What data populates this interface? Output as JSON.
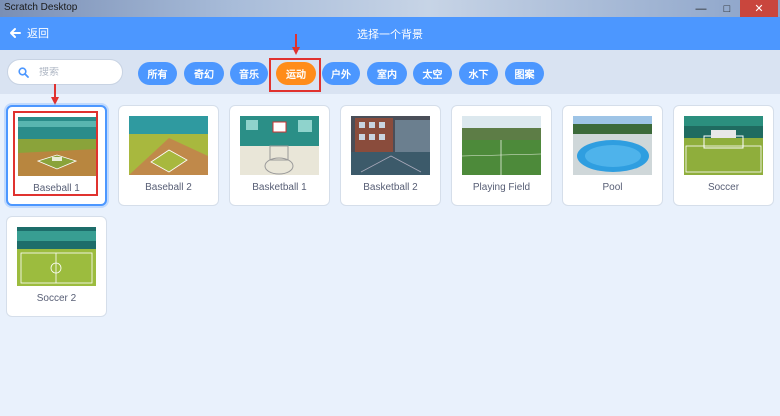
{
  "window": {
    "title": "Scratch Desktop",
    "controls": [
      "—",
      "□",
      "✕"
    ]
  },
  "header": {
    "back_label": "返回",
    "title": "选择一个背景"
  },
  "search": {
    "placeholder": "搜索"
  },
  "tags": [
    {
      "label": "所有",
      "active": false
    },
    {
      "label": "奇幻",
      "active": false
    },
    {
      "label": "音乐",
      "active": false
    },
    {
      "label": "运动",
      "active": true
    },
    {
      "label": "户外",
      "active": false
    },
    {
      "label": "室内",
      "active": false
    },
    {
      "label": "太空",
      "active": false
    },
    {
      "label": "水下",
      "active": false
    },
    {
      "label": "图案",
      "active": false
    }
  ],
  "backdrops": [
    {
      "name": "Baseball 1",
      "selected": true
    },
    {
      "name": "Baseball 2",
      "selected": false
    },
    {
      "name": "Basketball 1",
      "selected": false
    },
    {
      "name": "Basketball 2",
      "selected": false
    },
    {
      "name": "Playing Field",
      "selected": false
    },
    {
      "name": "Pool",
      "selected": false
    },
    {
      "name": "Soccer",
      "selected": false
    },
    {
      "name": "Soccer 2",
      "selected": false
    }
  ],
  "colors": {
    "accent": "#4c97ff",
    "active_tag": "#ff8c1a",
    "annotation": "#e0322f"
  }
}
